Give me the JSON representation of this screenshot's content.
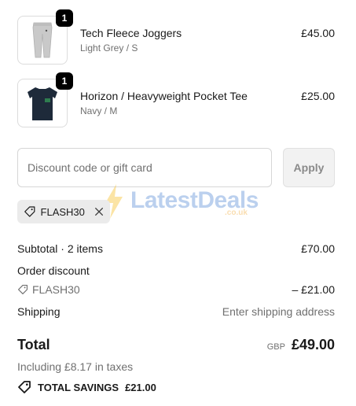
{
  "cart": {
    "items": [
      {
        "quantity": "1",
        "name": "Tech Fleece Joggers",
        "variant": "Light Grey / S",
        "price": "£45.00",
        "thumb_icon": "joggers-image"
      },
      {
        "quantity": "1",
        "name": "Horizon / Heavyweight Pocket Tee",
        "variant": "Navy / M",
        "price": "£25.00",
        "thumb_icon": "tshirt-image"
      }
    ]
  },
  "discount": {
    "placeholder": "Discount code or gift card",
    "value": "",
    "apply_label": "Apply",
    "applied_code": "FLASH30"
  },
  "watermark": {
    "text": "LatestDeals",
    "sub": ".co.uk"
  },
  "summary": {
    "subtotal_label": "Subtotal · 2 items",
    "subtotal_value": "£70.00",
    "order_discount_label": "Order discount",
    "discount_code": "FLASH30",
    "discount_value": "– £21.00",
    "shipping_label": "Shipping",
    "shipping_value": "Enter shipping address",
    "total_label": "Total",
    "currency": "GBP",
    "total_value": "£49.00",
    "taxes_text": "Including £8.17 in taxes",
    "savings_label": "TOTAL SAVINGS",
    "savings_value": "£21.00"
  },
  "colors": {
    "text": "#1a1a1a",
    "muted": "#707070",
    "chip_bg": "#ebebeb",
    "apply_bg": "#f2f2f2",
    "badge_bg": "#000000"
  }
}
